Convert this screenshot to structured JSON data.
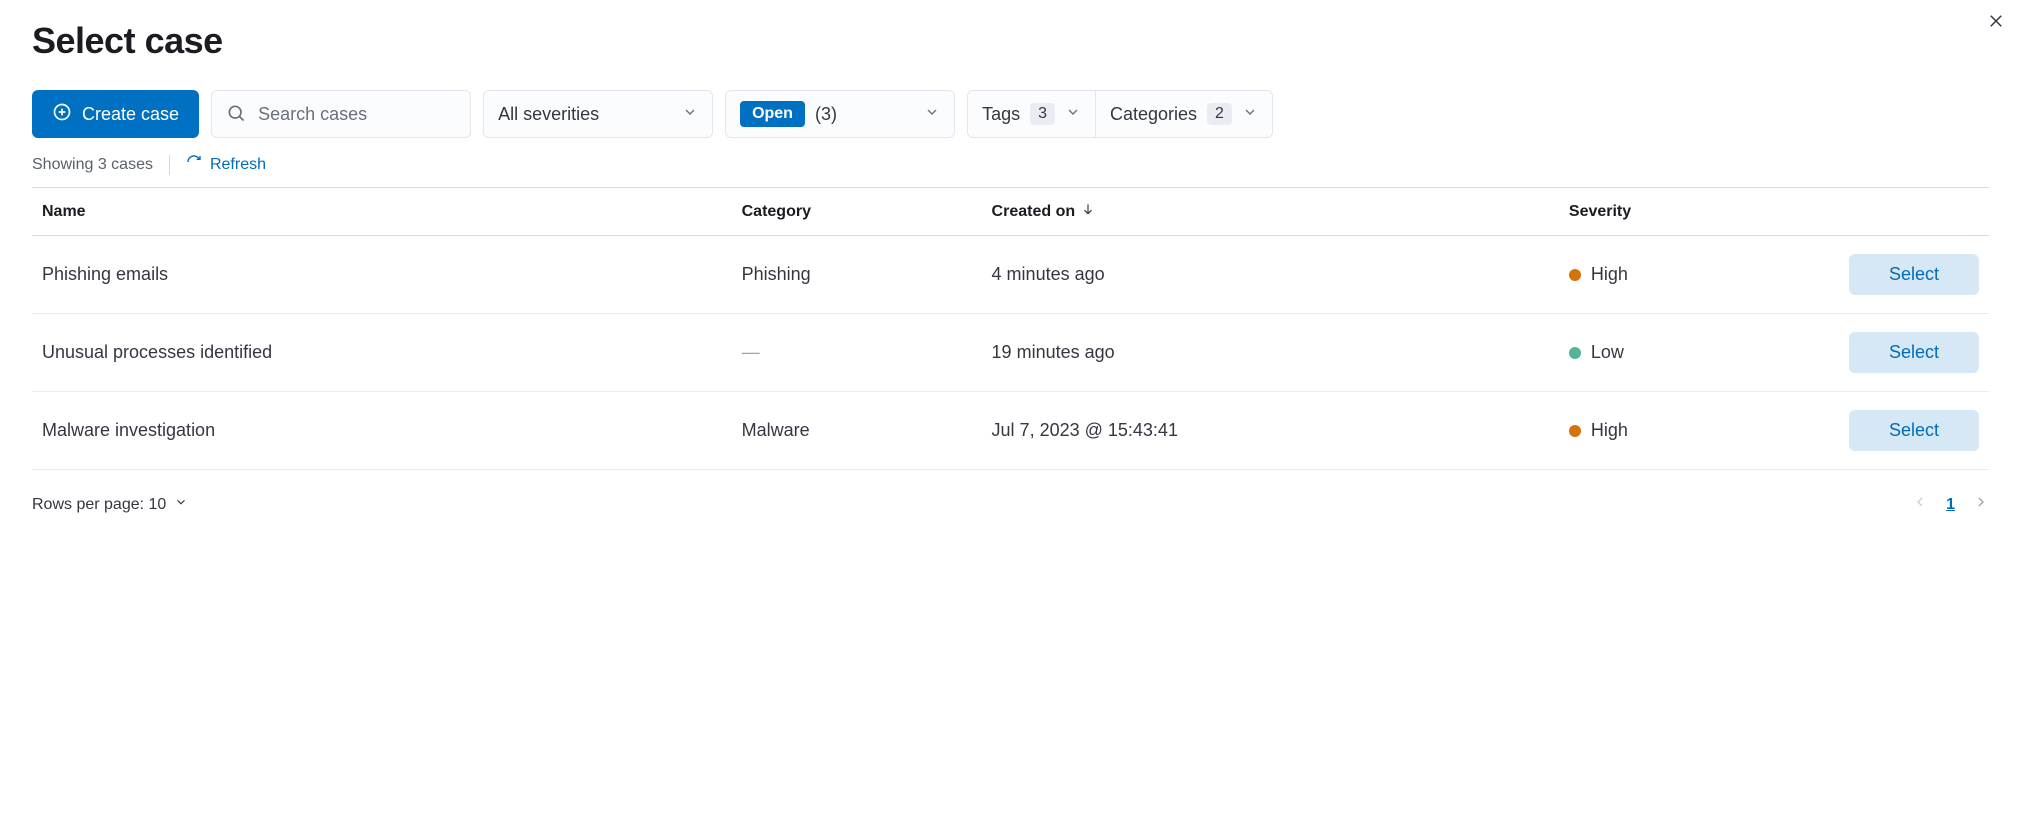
{
  "title": "Select case",
  "toolbar": {
    "create_label": "Create case",
    "search_placeholder": "Search cases",
    "severity_filter": {
      "label": "All severities"
    },
    "status_filter": {
      "badge": "Open",
      "count_text": "(3)"
    },
    "tags_filter": {
      "label": "Tags",
      "count": "3"
    },
    "categories_filter": {
      "label": "Categories",
      "count": "2"
    }
  },
  "status": {
    "showing_text": "Showing 3 cases",
    "refresh_label": "Refresh"
  },
  "columns": {
    "name": "Name",
    "category": "Category",
    "created": "Created on",
    "severity": "Severity"
  },
  "rows": [
    {
      "name": "Phishing emails",
      "category": "Phishing",
      "created": "4 minutes ago",
      "severity_label": "High",
      "severity_color": "#d6720a",
      "select_label": "Select"
    },
    {
      "name": "Unusual processes identified",
      "category": "—",
      "created": "19 minutes ago",
      "severity_label": "Low",
      "severity_color": "#54b399",
      "select_label": "Select"
    },
    {
      "name": "Malware investigation",
      "category": "Malware",
      "created": "Jul 7, 2023 @ 15:43:41",
      "severity_label": "High",
      "severity_color": "#d6720a",
      "select_label": "Select"
    }
  ],
  "footer": {
    "rows_per_page_text": "Rows per page: 10",
    "current_page": "1"
  }
}
